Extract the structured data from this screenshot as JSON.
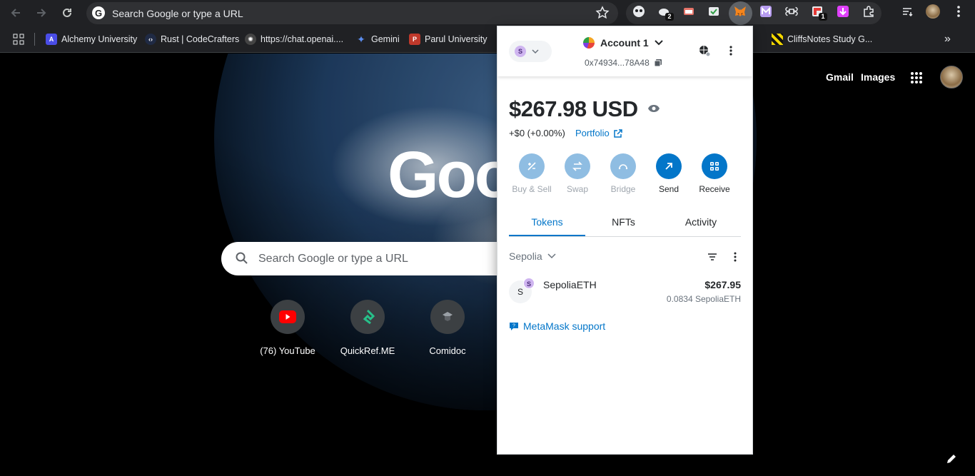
{
  "toolbar": {
    "omnibox_placeholder": "Search Google or type a URL",
    "ext_badge_1": "2",
    "ext_badge_2": "1"
  },
  "bookmarks": [
    {
      "label": "Alchemy University",
      "color": "#4a4de6"
    },
    {
      "label": "Rust | CodeCrafters",
      "color": "#1f2a44"
    },
    {
      "label": "https://chat.openai....",
      "color": "#444"
    },
    {
      "label": "Gemini",
      "color": "#5b8def"
    },
    {
      "label": "Parul University",
      "color": "#c0392b"
    },
    {
      "label": "CliffsNotes Study G...",
      "color": "#f2d600"
    }
  ],
  "page": {
    "logo": "Goog",
    "search_placeholder": "Search Google or type a URL",
    "gmail": "Gmail",
    "images": "Images",
    "shortcuts": [
      {
        "label": "(76) YouTube"
      },
      {
        "label": "QuickRef.ME"
      },
      {
        "label": "Comidoc"
      }
    ]
  },
  "metamask": {
    "network_letter": "S",
    "account_name": "Account 1",
    "account_address": "0x74934...78A48",
    "balance": "$267.98 USD",
    "change": "+$0 (+0.00%)",
    "portfolio": "Portfolio",
    "actions": [
      {
        "label": "Buy & Sell",
        "enabled": false
      },
      {
        "label": "Swap",
        "enabled": false
      },
      {
        "label": "Bridge",
        "enabled": false
      },
      {
        "label": "Send",
        "enabled": true
      },
      {
        "label": "Receive",
        "enabled": true
      }
    ],
    "tabs": [
      "Tokens",
      "NFTs",
      "Activity"
    ],
    "active_tab": "Tokens",
    "network_filter": "Sepolia",
    "token": {
      "icon_letter": "S",
      "badge_letter": "S",
      "name": "SepoliaETH",
      "fiat": "$267.95",
      "amount": "0.0834 SepoliaETH"
    },
    "support": "MetaMask support",
    "colors": {
      "primary": "#0376c9",
      "disabled": "#8fbde2"
    }
  }
}
